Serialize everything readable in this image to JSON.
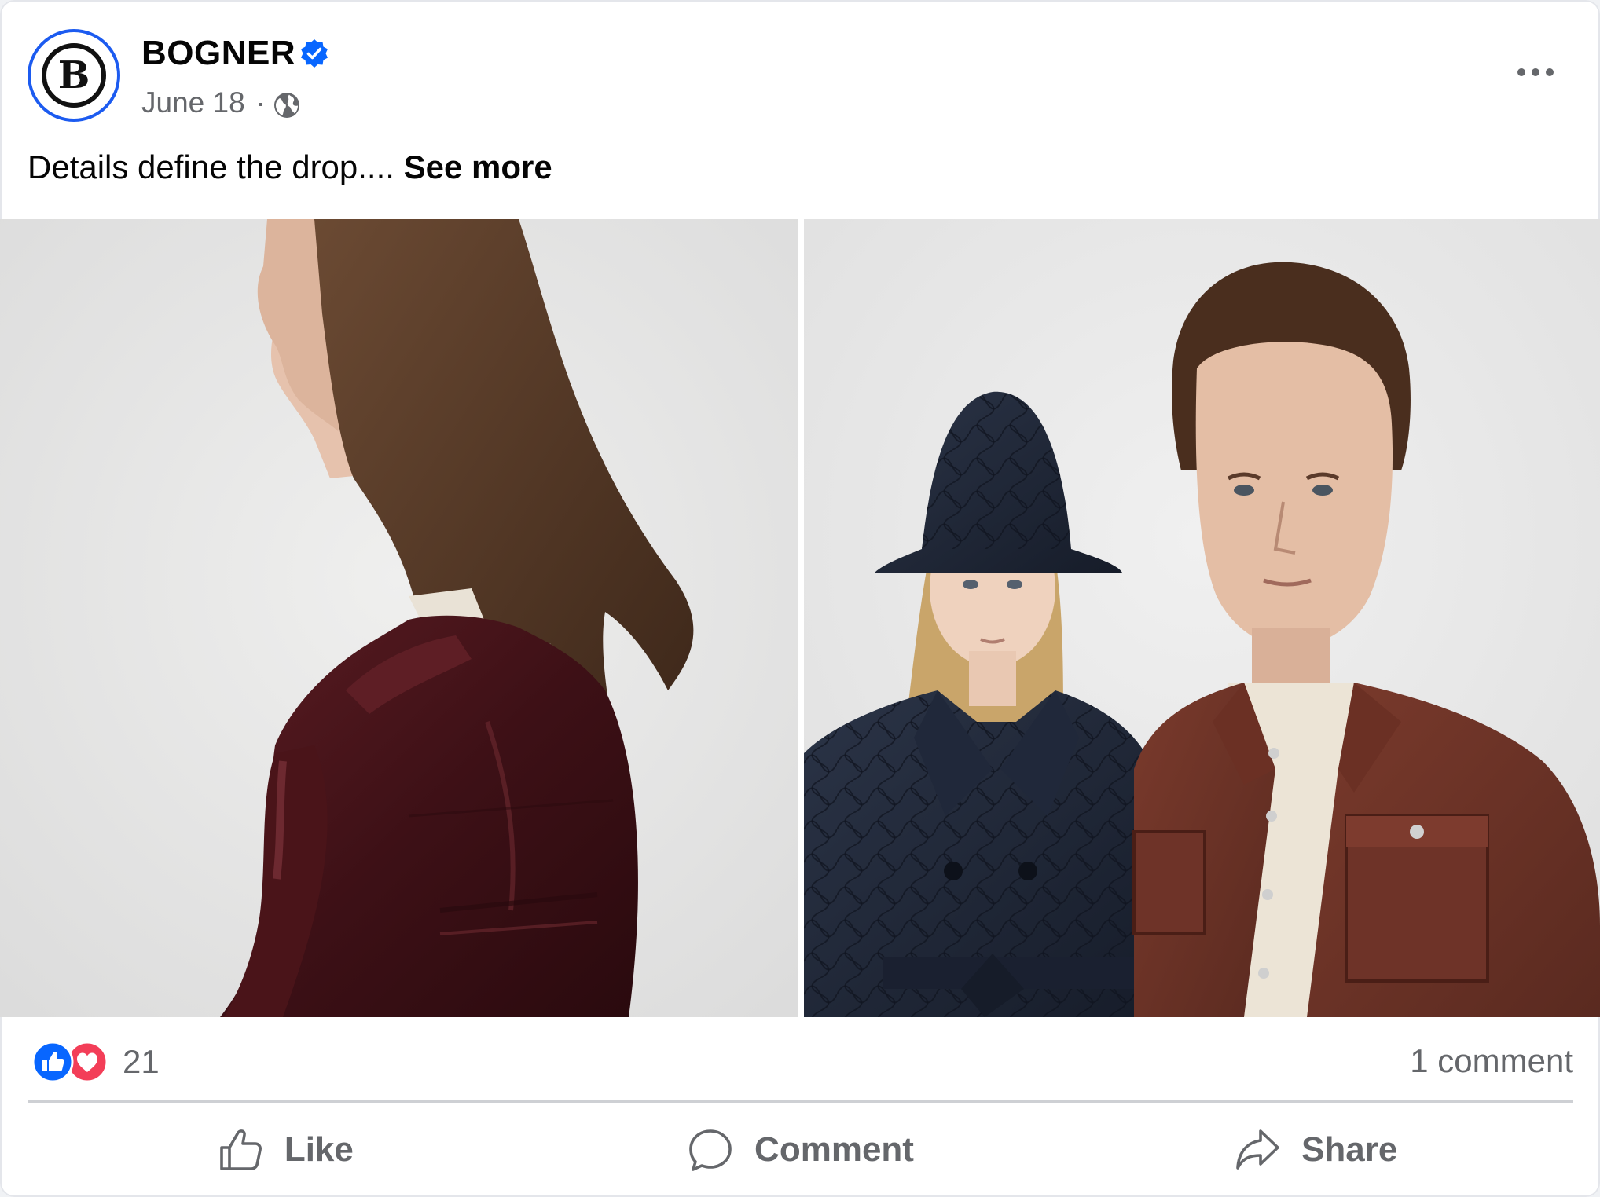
{
  "post": {
    "page_name": "BOGNER",
    "avatar_letter": "B",
    "verified": true,
    "date": "June 18",
    "separator": "·",
    "audience_icon": "globe-icon",
    "text": "Details define the drop.... ",
    "see_more": "See more"
  },
  "images": [
    {
      "name": "photo-woman-leather-jacket"
    },
    {
      "name": "photo-couple-quilted-coat-and-shirt-jacket"
    }
  ],
  "engagement": {
    "reaction_icons": [
      "like-icon",
      "love-icon"
    ],
    "reaction_count": "21",
    "comment_count": "1 comment"
  },
  "actions": {
    "like": "Like",
    "comment": "Comment",
    "share": "Share"
  },
  "colors": {
    "brand_blue": "#0866ff",
    "love_red": "#f33e58",
    "secondary_text": "#65676b"
  }
}
